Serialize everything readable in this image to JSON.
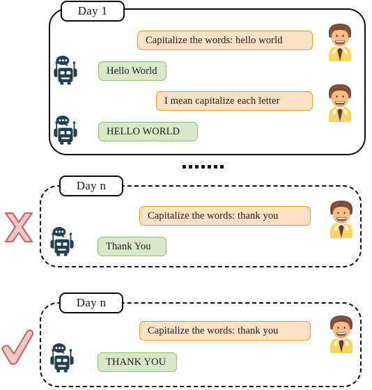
{
  "figure": {
    "separator": {
      "icon": "ellipsis-dots",
      "dot_count": 7
    }
  },
  "sections": [
    {
      "id": "day-1",
      "day_label": "Day 1",
      "border_style": "solid",
      "verdict": null,
      "messages": [
        {
          "role": "user",
          "text": "Capitalize the words: hello world"
        },
        {
          "role": "bot",
          "text": "Hello World"
        },
        {
          "role": "user",
          "text": "I mean capitalize each letter"
        },
        {
          "role": "bot",
          "text": "HELLO WORLD"
        }
      ]
    },
    {
      "id": "day-n-fail",
      "day_label": "Day n",
      "border_style": "dashed",
      "verdict": {
        "icon": "cross-mark",
        "meaning": "incorrect"
      },
      "messages": [
        {
          "role": "user",
          "text": "Capitalize the words: thank you"
        },
        {
          "role": "bot",
          "text": "Thank You"
        }
      ]
    },
    {
      "id": "day-n-pass",
      "day_label": "Day n",
      "border_style": "dashed",
      "verdict": {
        "icon": "check-mark",
        "meaning": "correct"
      },
      "messages": [
        {
          "role": "user",
          "text": "Capitalize the words: thank you"
        },
        {
          "role": "bot",
          "text": "THANK YOU"
        }
      ]
    }
  ],
  "icons": {
    "robot": "robot-avatar-icon",
    "person": "person-avatar-icon",
    "cross": "cross-mark-icon",
    "check": "check-mark-icon"
  },
  "colors": {
    "user_bubble_fill": "#fce1c4",
    "user_bubble_border": "#e3a11a",
    "bot_bubble_fill": "#d8e9c9",
    "bot_bubble_border": "#8dbc6c",
    "robot": "#23404f",
    "verdict_fill": "#f6c5c5",
    "verdict_stroke": "#c06a6a",
    "panel_border": "#0d0d0d"
  }
}
